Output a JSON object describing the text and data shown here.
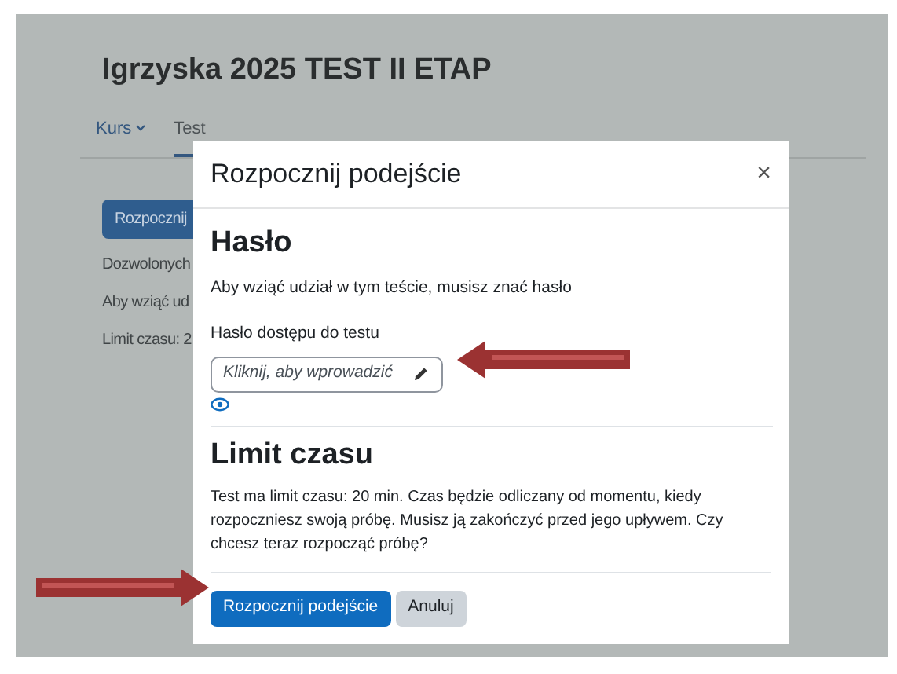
{
  "page": {
    "title": "Igrzyska 2025 TEST II ETAP",
    "tabs": [
      {
        "label": "Kurs",
        "selected": false,
        "dropdown": true
      },
      {
        "label": "Test",
        "selected": true,
        "dropdown": false
      }
    ],
    "start_button": "Rozpocznij",
    "info_lines": [
      "Dozwolonych",
      "Aby wziąć ud",
      "Limit czasu: 2"
    ]
  },
  "dialog": {
    "title": "Rozpocznij podejście",
    "close": "×",
    "password_section": {
      "heading": "Hasło",
      "text": "Aby wziąć udział w tym teście, musisz znać hasło",
      "field_label": "Hasło dostępu do testu",
      "placeholder": "Kliknij, aby wprowadzić"
    },
    "time_section": {
      "heading": "Limit czasu",
      "text": "Test ma limit czasu: 20 min. Czas będzie odliczany od momentu, kiedy rozpoczniesz swoją próbę. Musisz ją zakończyć przed jego upływem. Czy chcesz teraz rozpocząć próbę?"
    },
    "buttons": [
      {
        "label": "Rozpocznij podejście",
        "kind": "primary"
      },
      {
        "label": "Anuluj",
        "kind": "secondary"
      }
    ]
  }
}
